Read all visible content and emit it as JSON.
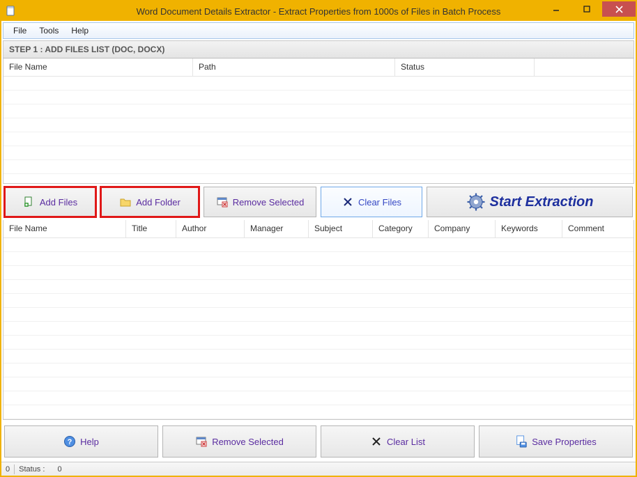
{
  "window": {
    "title": "Word Document Details Extractor - Extract Properties from 1000s of Files in Batch Process"
  },
  "menu": {
    "file": "File",
    "tools": "Tools",
    "help": "Help"
  },
  "step_header": "STEP 1 : ADD FILES LIST (DOC, DOCX)",
  "grid_top": {
    "cols": {
      "filename": "File Name",
      "path": "Path",
      "status": "Status"
    }
  },
  "mid_buttons": {
    "add_files": "Add Files",
    "add_folder": "Add Folder",
    "remove_selected": "Remove Selected",
    "clear_files": "Clear Files",
    "start": "Start Extraction"
  },
  "grid_bottom": {
    "cols": {
      "filename": "File Name",
      "title": "Title",
      "author": "Author",
      "manager": "Manager",
      "subject": "Subject",
      "category": "Category",
      "company": "Company",
      "keywords": "Keywords",
      "comment": "Comment"
    }
  },
  "bot_buttons": {
    "help": "Help",
    "remove_selected": "Remove Selected",
    "clear_list": "Clear List",
    "save_properties": "Save Properties"
  },
  "statusbar": {
    "left_num": "0",
    "status_label": "Status :",
    "status_value": "0"
  }
}
